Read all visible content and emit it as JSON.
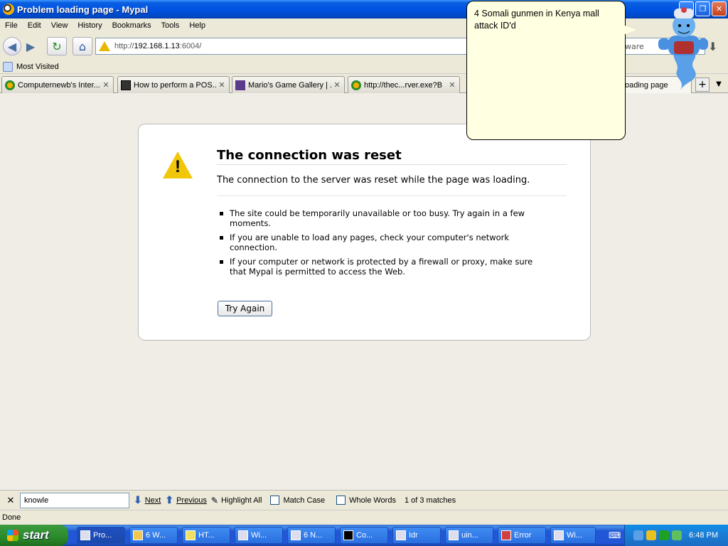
{
  "window": {
    "title": "Problem loading page - Mypal",
    "buttons": {
      "minimize": "_",
      "restore": "❐",
      "close": "✕"
    }
  },
  "menu": [
    "File",
    "Edit",
    "View",
    "History",
    "Bookmarks",
    "Tools",
    "Help"
  ],
  "nav": {
    "url_prefix": "http://",
    "url_host": "192.168.1.13",
    "url_port": ":6004/",
    "search_text": "ware"
  },
  "bookmarks": {
    "most_visited": "Most Visited"
  },
  "tabs": [
    {
      "label": "Computernewb's Inter..."
    },
    {
      "label": "How to perform a POS..."
    },
    {
      "label": "Mario's Game Gallery | ..."
    },
    {
      "label": "http://thec...rver.exe?B"
    },
    {
      "label": "oading page"
    }
  ],
  "error": {
    "title": "The connection was reset",
    "description": "The connection to the server was reset while the page was loading.",
    "items": [
      "The site could be temporarily unavailable or too busy. Try again in a few moments.",
      "If you are unable to load any pages, check your computer's network connection.",
      "If your computer or network is protected by a firewall or proxy, make sure that Mypal is permitted to access the Web."
    ],
    "button": "Try Again"
  },
  "balloon": {
    "text": "4 Somali gunmen in Kenya mall attack ID'd"
  },
  "findbar": {
    "close": "✕",
    "value": "knowle",
    "next": "Next",
    "previous": "Previous",
    "highlight": "Highlight All",
    "match_case": "Match Case",
    "whole_words": "Whole Words",
    "result": "1 of 3 matches"
  },
  "status": "Done",
  "taskbar": {
    "start": "start",
    "tasks": [
      "Pro...",
      "6 W...",
      "HT...",
      "Wi...",
      "6 N...",
      "Co...",
      "Idr",
      "uin...",
      "Error",
      "Wi..."
    ],
    "clock": "6:48 PM"
  },
  "colors": {
    "titlebar": "#0054e3",
    "balloon": "#ffffe1",
    "warning": "#f1c70a"
  }
}
